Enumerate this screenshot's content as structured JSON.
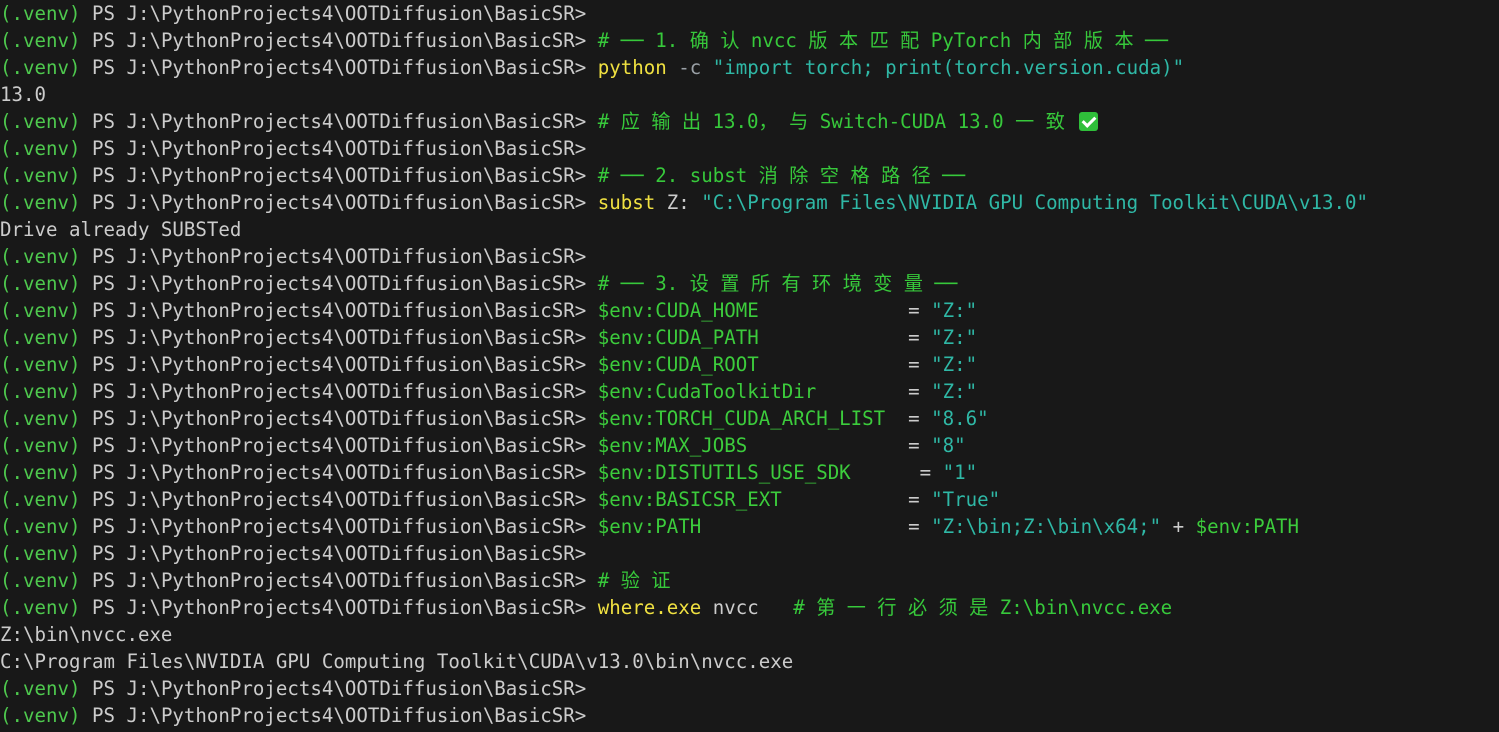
{
  "terminal": {
    "lines": [
      [
        {
          "t": "(.venv) ",
          "c": "venv"
        },
        {
          "t": "PS J:\\PythonProjects4\\OOTDiffusion\\BasicSR>",
          "c": "ps"
        }
      ],
      [
        {
          "t": "(.venv) ",
          "c": "venv"
        },
        {
          "t": "PS J:\\PythonProjects4\\OOTDiffusion\\BasicSR> ",
          "c": "ps"
        },
        {
          "t": "# ── 1. 确 认 nvcc 版 本 匹 配 PyTorch 内 部 版 本 ──",
          "c": "comment"
        }
      ],
      [
        {
          "t": "(.venv) ",
          "c": "venv"
        },
        {
          "t": "PS J:\\PythonProjects4\\OOTDiffusion\\BasicSR> ",
          "c": "ps"
        },
        {
          "t": "python",
          "c": "cmd"
        },
        {
          "t": " -c ",
          "c": "flag"
        },
        {
          "t": "\"import torch; print(torch.version.cuda)\"",
          "c": "str"
        }
      ],
      [
        {
          "t": "13.0",
          "c": "plain"
        }
      ],
      [
        {
          "t": "(.venv) ",
          "c": "venv"
        },
        {
          "t": "PS J:\\PythonProjects4\\OOTDiffusion\\BasicSR> ",
          "c": "ps"
        },
        {
          "t": "# 应 输 出 13.0， 与 Switch-CUDA 13.0 一 致 ",
          "c": "comment"
        },
        {
          "icon": "check-icon"
        }
      ],
      [
        {
          "t": "(.venv) ",
          "c": "venv"
        },
        {
          "t": "PS J:\\PythonProjects4\\OOTDiffusion\\BasicSR>",
          "c": "ps"
        }
      ],
      [
        {
          "t": "(.venv) ",
          "c": "venv"
        },
        {
          "t": "PS J:\\PythonProjects4\\OOTDiffusion\\BasicSR> ",
          "c": "ps"
        },
        {
          "t": "# ── 2. subst 消 除 空 格 路 径 ──",
          "c": "comment"
        }
      ],
      [
        {
          "t": "(.venv) ",
          "c": "venv"
        },
        {
          "t": "PS J:\\PythonProjects4\\OOTDiffusion\\BasicSR> ",
          "c": "ps"
        },
        {
          "t": "subst",
          "c": "cmd"
        },
        {
          "t": " Z: ",
          "c": "plain"
        },
        {
          "t": "\"C:\\Program Files\\NVIDIA GPU Computing Toolkit\\CUDA\\v13.0\"",
          "c": "str"
        }
      ],
      [
        {
          "t": "Drive already SUBSTed",
          "c": "plain"
        }
      ],
      [
        {
          "t": "(.venv) ",
          "c": "venv"
        },
        {
          "t": "PS J:\\PythonProjects4\\OOTDiffusion\\BasicSR>",
          "c": "ps"
        }
      ],
      [
        {
          "t": "(.venv) ",
          "c": "venv"
        },
        {
          "t": "PS J:\\PythonProjects4\\OOTDiffusion\\BasicSR> ",
          "c": "ps"
        },
        {
          "t": "# ── 3. 设 置 所 有 环 境 变 量 ──",
          "c": "comment"
        }
      ],
      [
        {
          "t": "(.venv) ",
          "c": "venv"
        },
        {
          "t": "PS J:\\PythonProjects4\\OOTDiffusion\\BasicSR> ",
          "c": "ps"
        },
        {
          "t": "$env:CUDA_HOME",
          "c": "var"
        },
        {
          "t": "             = ",
          "c": "op"
        },
        {
          "t": "\"Z:\"",
          "c": "str"
        }
      ],
      [
        {
          "t": "(.venv) ",
          "c": "venv"
        },
        {
          "t": "PS J:\\PythonProjects4\\OOTDiffusion\\BasicSR> ",
          "c": "ps"
        },
        {
          "t": "$env:CUDA_PATH",
          "c": "var"
        },
        {
          "t": "             = ",
          "c": "op"
        },
        {
          "t": "\"Z:\"",
          "c": "str"
        }
      ],
      [
        {
          "t": "(.venv) ",
          "c": "venv"
        },
        {
          "t": "PS J:\\PythonProjects4\\OOTDiffusion\\BasicSR> ",
          "c": "ps"
        },
        {
          "t": "$env:CUDA_ROOT",
          "c": "var"
        },
        {
          "t": "             = ",
          "c": "op"
        },
        {
          "t": "\"Z:\"",
          "c": "str"
        }
      ],
      [
        {
          "t": "(.venv) ",
          "c": "venv"
        },
        {
          "t": "PS J:\\PythonProjects4\\OOTDiffusion\\BasicSR> ",
          "c": "ps"
        },
        {
          "t": "$env:CudaToolkitDir",
          "c": "var"
        },
        {
          "t": "        = ",
          "c": "op"
        },
        {
          "t": "\"Z:\"",
          "c": "str"
        }
      ],
      [
        {
          "t": "(.venv) ",
          "c": "venv"
        },
        {
          "t": "PS J:\\PythonProjects4\\OOTDiffusion\\BasicSR> ",
          "c": "ps"
        },
        {
          "t": "$env:TORCH_CUDA_ARCH_LIST",
          "c": "var"
        },
        {
          "t": "  = ",
          "c": "op"
        },
        {
          "t": "\"8.6\"",
          "c": "str"
        }
      ],
      [
        {
          "t": "(.venv) ",
          "c": "venv"
        },
        {
          "t": "PS J:\\PythonProjects4\\OOTDiffusion\\BasicSR> ",
          "c": "ps"
        },
        {
          "t": "$env:MAX_JOBS",
          "c": "var"
        },
        {
          "t": "              = ",
          "c": "op"
        },
        {
          "t": "\"8\"",
          "c": "str"
        }
      ],
      [
        {
          "t": "(.venv) ",
          "c": "venv"
        },
        {
          "t": "PS J:\\PythonProjects4\\OOTDiffusion\\BasicSR> ",
          "c": "ps"
        },
        {
          "t": "$env:DISTUTILS_USE_SDK",
          "c": "var"
        },
        {
          "t": "      = ",
          "c": "op"
        },
        {
          "t": "\"1\"",
          "c": "str"
        }
      ],
      [
        {
          "t": "(.venv) ",
          "c": "venv"
        },
        {
          "t": "PS J:\\PythonProjects4\\OOTDiffusion\\BasicSR> ",
          "c": "ps"
        },
        {
          "t": "$env:BASICSR_EXT",
          "c": "var"
        },
        {
          "t": "           = ",
          "c": "op"
        },
        {
          "t": "\"True\"",
          "c": "str"
        }
      ],
      [
        {
          "t": "(.venv) ",
          "c": "venv"
        },
        {
          "t": "PS J:\\PythonProjects4\\OOTDiffusion\\BasicSR> ",
          "c": "ps"
        },
        {
          "t": "$env:PATH",
          "c": "var"
        },
        {
          "t": "                  = ",
          "c": "op"
        },
        {
          "t": "\"Z:\\bin;Z:\\bin\\x64;\"",
          "c": "str"
        },
        {
          "t": " + ",
          "c": "op"
        },
        {
          "t": "$env:PATH",
          "c": "var"
        }
      ],
      [
        {
          "t": "(.venv) ",
          "c": "venv"
        },
        {
          "t": "PS J:\\PythonProjects4\\OOTDiffusion\\BasicSR>",
          "c": "ps"
        }
      ],
      [
        {
          "t": "(.venv) ",
          "c": "venv"
        },
        {
          "t": "PS J:\\PythonProjects4\\OOTDiffusion\\BasicSR> ",
          "c": "ps"
        },
        {
          "t": "# 验 证",
          "c": "comment"
        }
      ],
      [
        {
          "t": "(.venv) ",
          "c": "venv"
        },
        {
          "t": "PS J:\\PythonProjects4\\OOTDiffusion\\BasicSR> ",
          "c": "ps"
        },
        {
          "t": "where.exe",
          "c": "cmd"
        },
        {
          "t": " nvcc   ",
          "c": "plain"
        },
        {
          "t": "# 第 一 行 必 须 是 Z:\\bin\\nvcc.exe",
          "c": "comment"
        }
      ],
      [
        {
          "t": "Z:\\bin\\nvcc.exe",
          "c": "plain"
        }
      ],
      [
        {
          "t": "C:\\Program Files\\NVIDIA GPU Computing Toolkit\\CUDA\\v13.0\\bin\\nvcc.exe",
          "c": "plain"
        }
      ],
      [
        {
          "t": "(.venv) ",
          "c": "venv"
        },
        {
          "t": "PS J:\\PythonProjects4\\OOTDiffusion\\BasicSR>",
          "c": "ps"
        }
      ],
      [
        {
          "t": "(.venv) ",
          "c": "venv"
        },
        {
          "t": "PS J:\\PythonProjects4\\OOTDiffusion\\BasicSR>",
          "c": "ps"
        }
      ]
    ]
  },
  "colors": {
    "background": "#181818",
    "venv": "#4ec94e",
    "prompt": "#cccccc",
    "command": "#f0e141",
    "comment": "#37c93b",
    "string": "#2fb8a6",
    "variable": "#3ccc3c"
  }
}
